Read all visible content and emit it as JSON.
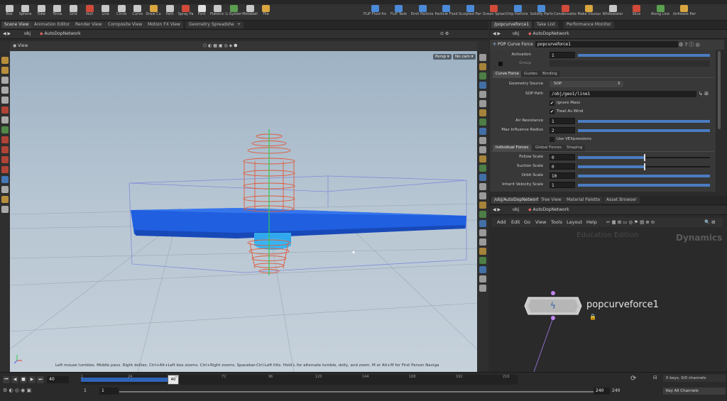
{
  "shelf": {
    "tools": [
      {
        "label": "Box",
        "icon": "box-icon",
        "color": "#c8c8c8"
      },
      {
        "label": "Sphere",
        "icon": "sphere-icon",
        "color": "#c8c8c8"
      },
      {
        "label": "Tube",
        "icon": "tube-icon",
        "color": "#c8c8c8"
      },
      {
        "label": "Torus",
        "icon": "torus-icon",
        "color": "#c8c8c8"
      },
      {
        "label": "Grid",
        "icon": "grid-icon",
        "color": "#c8c8c8"
      },
      {
        "label": "Null",
        "icon": "null-icon",
        "color": "#d14a3a"
      },
      {
        "label": "Line",
        "icon": "line-icon",
        "color": "#c8c8c8"
      },
      {
        "label": "Circle",
        "icon": "circle-icon",
        "color": "#c8c8c8"
      },
      {
        "label": "Curve",
        "icon": "curve-icon",
        "color": "#c8c8c8"
      },
      {
        "label": "Draw Curve",
        "icon": "draw-curve-icon",
        "color": "#d9a640"
      },
      {
        "label": "Path",
        "icon": "path-icon",
        "color": "#c8c8c8"
      },
      {
        "label": "Spray Paint",
        "icon": "spray-paint-icon",
        "color": "#d14a3a"
      },
      {
        "label": "Font",
        "icon": "font-icon",
        "color": "#e0e0e0"
      },
      {
        "label": "Platonic Solids",
        "icon": "platonic-solids-icon",
        "color": "#c8c8c8"
      },
      {
        "label": "L-System",
        "icon": "l-system-icon",
        "color": "#5aa050"
      },
      {
        "label": "Metaball",
        "icon": "metaball-icon",
        "color": "#c8c8c8"
      },
      {
        "label": "File",
        "icon": "file-icon",
        "color": "#d9a640"
      }
    ],
    "tools_right": [
      {
        "label": "FLIP Fluid from Object",
        "icon": "flip-fluid-object-icon",
        "color": "#4a8ad8"
      },
      {
        "label": "FLIP Tank",
        "icon": "flip-tank-icon",
        "color": "#4a8ad8"
      },
      {
        "label": "Emit Particle Fluid",
        "icon": "emit-particle-fluid-icon",
        "color": "#4a8ad8"
      },
      {
        "label": "Particle Fluid from Objects",
        "icon": "particle-fluid-objects-icon",
        "color": "#4a8ad8"
      },
      {
        "label": "Sculpted Particle Fluid",
        "icon": "sculpted-particle-fluid-icon",
        "color": "#4a8ad8"
      },
      {
        "label": "Ocean Splash Particle Fluid",
        "icon": "ocean-splash-icon",
        "color": "#d14a3a"
      },
      {
        "label": "Drip Particle Fluid",
        "icon": "drip-particle-fluid-icon",
        "color": "#4a8ad8"
      },
      {
        "label": "Solidify Particle Fluid",
        "icon": "solidify-particle-fluid-icon",
        "color": "#4a8ad8"
      },
      {
        "label": "Condensation",
        "icon": "condensation-icon",
        "color": "#d14a3a"
      },
      {
        "label": "Make Viscous",
        "icon": "make-viscous-icon",
        "color": "#d9a640"
      },
      {
        "label": "Whitewater",
        "icon": "whitewater-icon",
        "color": "#c8c8c8"
      },
      {
        "label": "Slice",
        "icon": "slice-icon",
        "color": "#d14a3a"
      },
      {
        "label": "Along Line",
        "icon": "along-line-icon",
        "color": "#5aa050"
      },
      {
        "label": "Unfreeze Particle Fluid",
        "icon": "unfreeze-icon",
        "color": "#d9a640"
      }
    ]
  },
  "left_tabs": [
    "Scene View",
    "Animation Editor",
    "Render View",
    "Composite View",
    "Motion FX View",
    "Geometry Spreadsheet"
  ],
  "right_tabs": [
    "/popcurveforce1",
    "Take List",
    "Performance Monitor"
  ],
  "left_path": {
    "obj": "obj",
    "network": "AutoDopNetwork"
  },
  "right_path": {
    "obj": "obj",
    "network": "AutoDopNetwork"
  },
  "viewport": {
    "title": "View",
    "persp": "Persp",
    "cam": "No cam",
    "status": "Left mouse tumbles. Middle pans. Right dollies. Ctrl+Alt+Left box zooms. Ctrl+Right zooms. Spacebar-Ctrl-Left tilts. Hold L for alternate tumble, dolly, and zoom.    M or Alt+M for First Person Navigation."
  },
  "params": {
    "node_type": "POP Curve Force",
    "node_name": "popcurveforce1",
    "activation_label": "Activation",
    "activation_value": "1",
    "group_label": "Group",
    "tabs": [
      "Curve Force",
      "Guides",
      "Binding"
    ],
    "geometry_source_label": "Geometry Source",
    "geometry_source_value": "SOP",
    "sop_path_label": "SOP Path",
    "sop_path_value": "/obj/geo1/line1",
    "ignore_mass": "Ignore Mass",
    "treat_as_wind": "Treat As Wind",
    "air_resistance_label": "Air Resistance",
    "air_resistance_value": "1",
    "max_influence_label": "Max Influence Radius",
    "max_influence_value": "2",
    "use_vex": "Use VEXpressions",
    "force_tabs": [
      "Individual Forces",
      "Global Forces",
      "Shaping"
    ],
    "follow_scale_label": "Follow Scale",
    "follow_scale_value": "0",
    "suction_scale_label": "Suction Scale",
    "suction_scale_value": "0",
    "orbit_scale_label": "Orbit Scale",
    "orbit_scale_value": "10",
    "inherit_velocity_label": "Inherit Velocity Scale",
    "inherit_velocity_value": "1"
  },
  "network": {
    "tabs": [
      "/obj/AutoDopNetwork",
      "Tree View",
      "Material Palette",
      "Asset Browser"
    ],
    "menu": [
      "Add",
      "Edit",
      "Go",
      "View",
      "Tools",
      "Layout",
      "Help"
    ],
    "watermark": "Education Edition",
    "context": "Dynamics",
    "node_name": "popcurveforce1"
  },
  "timeline": {
    "current_frame": "40",
    "start_frame": "1",
    "start_frame2": "1",
    "end_frame": "240",
    "end_frame2": "240",
    "ticks": [
      "1",
      "24",
      "48",
      "72",
      "96",
      "120",
      "144",
      "168",
      "192",
      "216"
    ],
    "keys_info": "0 keys, 0/0 channels",
    "key_channels": "Key All Channels"
  },
  "colors": {
    "accent": "#4a7cc0",
    "particles": "#1f5fe0",
    "curve": "#e05a3a"
  }
}
